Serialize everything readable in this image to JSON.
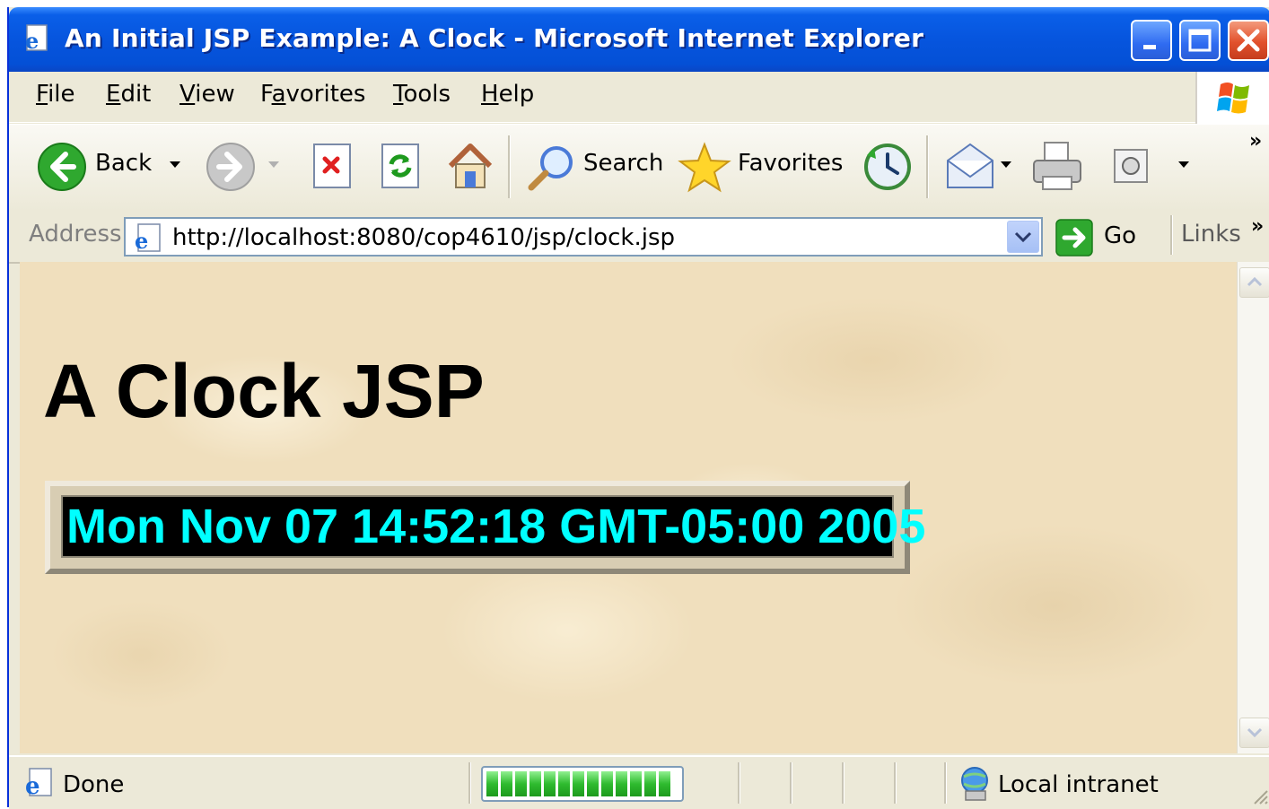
{
  "window": {
    "title": "An Initial JSP Example: A Clock - Microsoft Internet Explorer",
    "controls": [
      "minimize",
      "maximize",
      "close"
    ]
  },
  "menu": {
    "items": [
      {
        "label": "File",
        "mnemonic": "F"
      },
      {
        "label": "Edit",
        "mnemonic": "E"
      },
      {
        "label": "View",
        "mnemonic": "V"
      },
      {
        "label": "Favorites",
        "mnemonic": "a"
      },
      {
        "label": "Tools",
        "mnemonic": "T"
      },
      {
        "label": "Help",
        "mnemonic": "H"
      }
    ]
  },
  "toolbar": {
    "back_label": "Back",
    "search_label": "Search",
    "favorites_label": "Favorites",
    "overflow": "»"
  },
  "address": {
    "label": "Address",
    "url": "http://localhost:8080/cop4610/jsp/clock.jsp",
    "go_label": "Go",
    "links_label": "Links",
    "links_overflow": "»"
  },
  "page": {
    "heading": "A Clock JSP",
    "clock_text": "Mon Nov 07 14:52:18 GMT-05:00 2005"
  },
  "status": {
    "text": "Done",
    "progress": 1.0,
    "zone": "Local intranet"
  },
  "colors": {
    "titlebar": "#0655de",
    "clock_background": "#000000",
    "clock_text": "#00ffff",
    "page_background": "#f0dfbd"
  }
}
